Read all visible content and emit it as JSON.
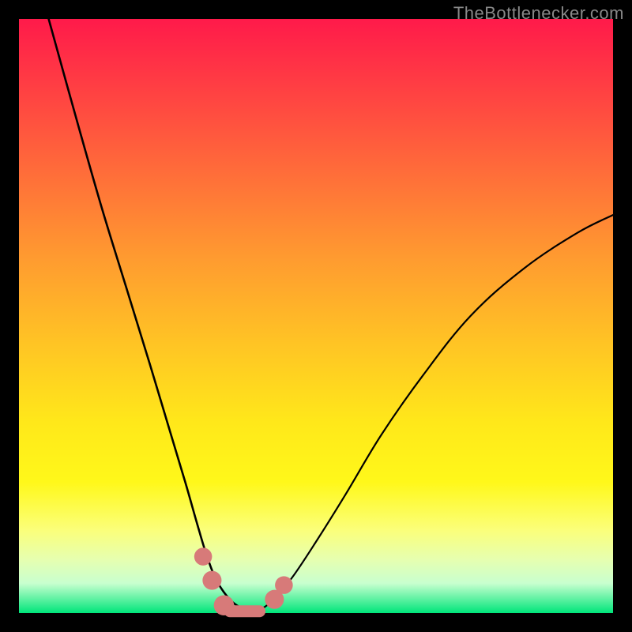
{
  "watermark": "TheBottlenecker.com",
  "colors": {
    "frame": "#000000",
    "curve": "#000000",
    "markers": "#d77a79",
    "gradient_stops": [
      "#ff1a4a",
      "#ff3a44",
      "#ff6a3a",
      "#ff9a30",
      "#ffc524",
      "#ffe81a",
      "#fff81a",
      "#fbff7a",
      "#e6ffb0",
      "#c8ffcf",
      "#00e57a"
    ]
  },
  "chart_data": {
    "type": "line",
    "title": "",
    "xlabel": "",
    "ylabel": "",
    "xlim": [
      0,
      100
    ],
    "ylim": [
      0,
      100
    ],
    "note": "Axes are unlabeled; x/y expressed as 0–100% of plot area. y=0 is bottom (green), y=100 is top (red). Two branches of a V-shaped curve meeting near the bottom, plus rounded markers near the trough.",
    "series": [
      {
        "name": "left-branch",
        "x": [
          5,
          10,
          14,
          18,
          22,
          25,
          28,
          30,
          31.5,
          33,
          34.5,
          36,
          37.5,
          39
        ],
        "y": [
          100,
          82,
          68,
          55,
          42,
          32,
          22,
          15,
          10,
          6,
          3.5,
          1.8,
          0.8,
          0.2
        ]
      },
      {
        "name": "right-branch",
        "x": [
          39,
          41,
          43,
          46,
          50,
          55,
          61,
          68,
          76,
          85,
          94,
          100
        ],
        "y": [
          0.2,
          0.8,
          2.5,
          6,
          12,
          20,
          30,
          40,
          50,
          58,
          64,
          67
        ]
      }
    ],
    "markers": [
      {
        "shape": "round",
        "x": 31.0,
        "y": 9.5,
        "r": 1.5
      },
      {
        "shape": "round",
        "x": 32.5,
        "y": 5.5,
        "r": 1.6
      },
      {
        "shape": "round",
        "x": 34.5,
        "y": 1.3,
        "r": 1.7
      },
      {
        "shape": "pill",
        "x": 38.0,
        "y": 0.3,
        "w": 7.0,
        "h": 2.0
      },
      {
        "shape": "round",
        "x": 43.0,
        "y": 2.3,
        "r": 1.6
      },
      {
        "shape": "round",
        "x": 44.6,
        "y": 4.7,
        "r": 1.5
      }
    ]
  }
}
